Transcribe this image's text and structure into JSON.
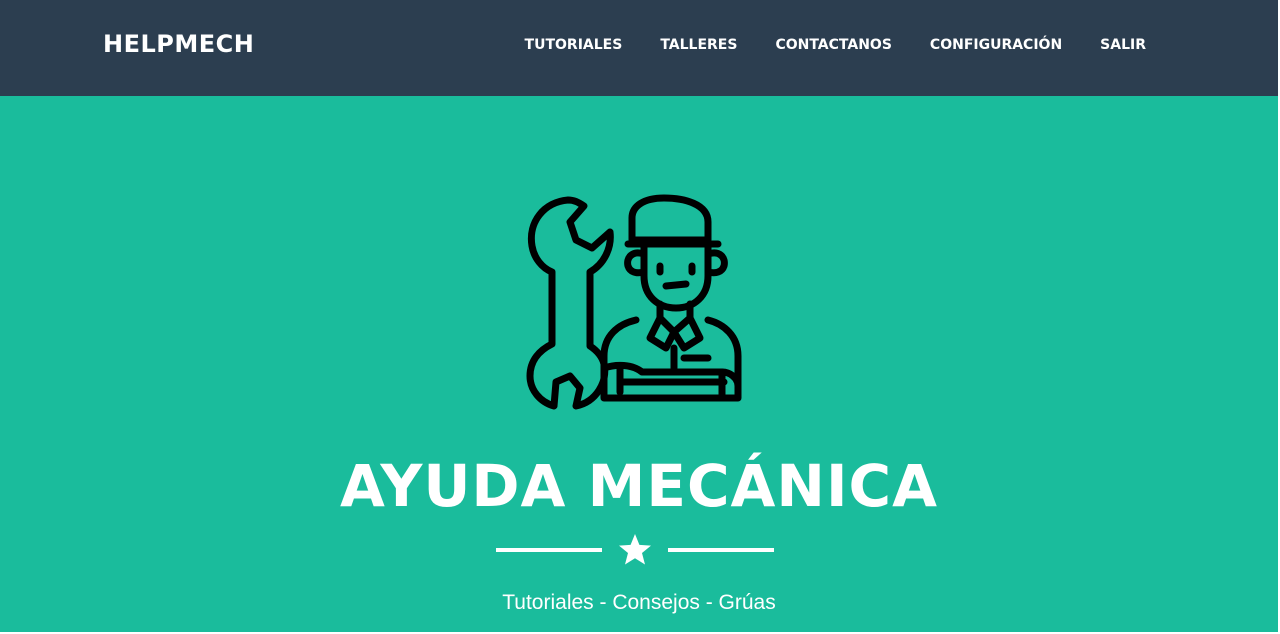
{
  "navbar": {
    "brand": "HELPMECH",
    "links": [
      {
        "label": "TUTORIALES"
      },
      {
        "label": "TALLERES"
      },
      {
        "label": "CONTACTANOS"
      },
      {
        "label": "CONFIGURACIÓN"
      },
      {
        "label": "SALIR"
      }
    ]
  },
  "hero": {
    "icon": "mechanic-with-wrench-icon",
    "title": "AYUDA MECÁNICA",
    "divider_icon": "star-icon",
    "subtitle": "Tutoriales - Consejos - Grúas"
  },
  "colors": {
    "navbar_bg": "#2c3e50",
    "hero_bg": "#1abc9c",
    "text": "#ffffff",
    "icon_stroke": "#000000"
  }
}
